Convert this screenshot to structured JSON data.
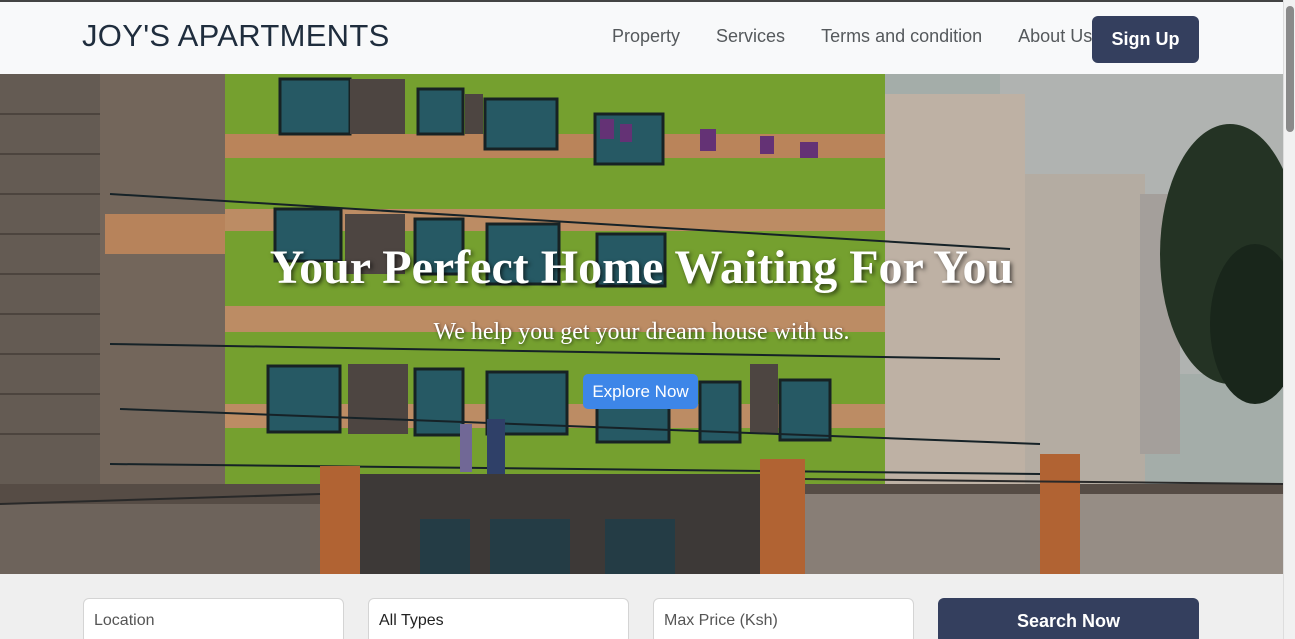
{
  "navbar": {
    "brand": "JOY'S APARTMENTS",
    "links": [
      "Property",
      "Services",
      "Terms and condition",
      "About Us"
    ],
    "signup_label": "Sign Up"
  },
  "hero": {
    "title": "Your Perfect Home Waiting For You",
    "subtitle": "We help you get your dream house with us.",
    "cta_label": "Explore Now"
  },
  "search": {
    "location_placeholder": "Location",
    "type_value": "All Types",
    "price_placeholder": "Max Price (Ksh)",
    "button_label": "Search Now"
  },
  "colors": {
    "primary": "#343f5e",
    "accent": "#3d86e8",
    "building_green": "#a7d63a",
    "building_orange": "#d9773e"
  }
}
